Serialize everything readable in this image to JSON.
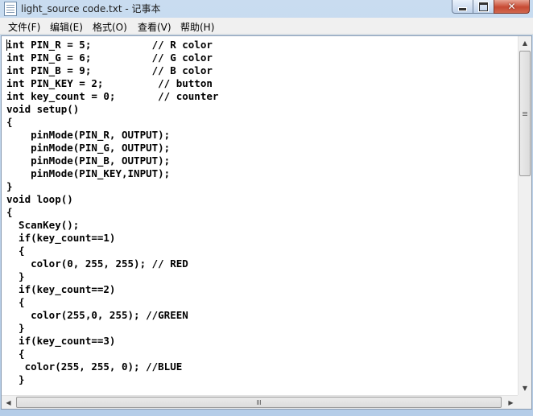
{
  "window": {
    "title": "light_source code.txt - 记事本",
    "controls": {
      "minimize": "minimize",
      "maximize": "maximize",
      "close_glyph": "✕"
    }
  },
  "menu": [
    {
      "label": "文件(F)"
    },
    {
      "label": "编辑(E)"
    },
    {
      "label": "格式(O)"
    },
    {
      "label": "查看(V)"
    },
    {
      "label": "帮助(H)"
    }
  ],
  "editor": {
    "lines": [
      "int PIN_R = 5;          // R color",
      "int PIN_G = 6;          // G color",
      "int PIN_B = 9;          // B color",
      "int PIN_KEY = 2;         // button",
      "int key_count = 0;       // counter",
      "void setup()",
      "{",
      "    pinMode(PIN_R, OUTPUT);",
      "    pinMode(PIN_G, OUTPUT);",
      "    pinMode(PIN_B, OUTPUT);",
      "    pinMode(PIN_KEY,INPUT);",
      "}",
      "void loop()",
      "{",
      "  ScanKey();",
      "  if(key_count==1)",
      "  {",
      "    color(0, 255, 255); // RED",
      "  }",
      "  if(key_count==2)",
      "  {",
      "    color(255,0, 255); //GREEN",
      "  }",
      "  if(key_count==3)",
      "  {",
      "   color(255, 255, 0); //BLUE",
      "  }"
    ]
  },
  "scrollbars": {
    "vertical_position": 0.0,
    "vertical_visible_fraction": 0.38,
    "horizontal_visible_fraction": 1.0
  },
  "colors": {
    "window_frame": "#b9d1ea",
    "text": "#000000",
    "close_button": "#c74a33"
  }
}
